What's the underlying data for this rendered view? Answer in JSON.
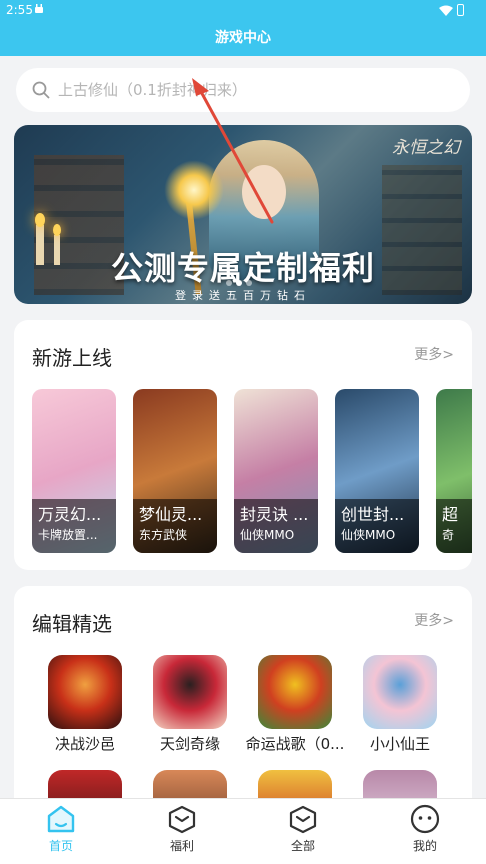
{
  "status_bar": {
    "time": "2:55"
  },
  "header": {
    "title": "游戏中心"
  },
  "search": {
    "placeholder": "上古修仙（0.1折封神归来）"
  },
  "banner": {
    "logo_text": "永恒之幻",
    "headline": "公测专属定制福利",
    "subline": "登录送五百万钻石",
    "dot_count": 3,
    "active_dot": 1
  },
  "new_games": {
    "title": "新游上线",
    "more": "更多>",
    "items": [
      {
        "name": "万灵幻...",
        "tag": "卡牌放置...",
        "colors": [
          "#f7c9d8",
          "#e7a6c6",
          "#bde0f0"
        ]
      },
      {
        "name": "梦仙灵...",
        "tag": "东方武侠",
        "colors": [
          "#8a3a20",
          "#c87a3a",
          "#3a2a1a"
        ]
      },
      {
        "name": "封灵诀 ...",
        "tag": "仙侠MMO",
        "colors": [
          "#efe2d6",
          "#c57fa5",
          "#7c9ab8"
        ]
      },
      {
        "name": "创世封...",
        "tag": "仙侠MMO",
        "colors": [
          "#2a4a6a",
          "#6f9cc7",
          "#1d2f44"
        ]
      },
      {
        "name": "超",
        "tag": "奇",
        "colors": [
          "#3e7a4a",
          "#7fbf6a",
          "#2a4a2a"
        ]
      }
    ]
  },
  "editor_picks": {
    "title": "编辑精选",
    "more": "更多>",
    "items": [
      {
        "name": "决战沙邑",
        "colors": [
          "#2a1010",
          "#c83018",
          "#f0a040"
        ]
      },
      {
        "name": "天剑奇缘",
        "colors": [
          "#f4d6c4",
          "#c82838",
          "#2a2020"
        ]
      },
      {
        "name": "命运战歌（0...",
        "colors": [
          "#3a8a3a",
          "#d04020",
          "#f0c020"
        ]
      },
      {
        "name": "小小仙王",
        "colors": [
          "#9fd4f0",
          "#f4c4d4",
          "#5aa0d8"
        ]
      }
    ],
    "partial_items_colors": [
      [
        "#3a1010",
        "#c02828"
      ],
      [
        "#5a3020",
        "#d88858"
      ],
      [
        "#c02018",
        "#f0c040"
      ],
      [
        "#e8d8e8",
        "#b888a8"
      ]
    ]
  },
  "tab_bar": {
    "items": [
      {
        "label": "首页",
        "icon": "home-icon",
        "active": true
      },
      {
        "label": "福利",
        "icon": "gift-box-icon",
        "active": false
      },
      {
        "label": "全部",
        "icon": "all-games-icon",
        "active": false
      },
      {
        "label": "我的",
        "icon": "profile-face-icon",
        "active": false
      }
    ]
  },
  "colors": {
    "accent": "#3cc6ef",
    "active_tab": "#34c3ef",
    "annotation_arrow": "#e04838"
  }
}
